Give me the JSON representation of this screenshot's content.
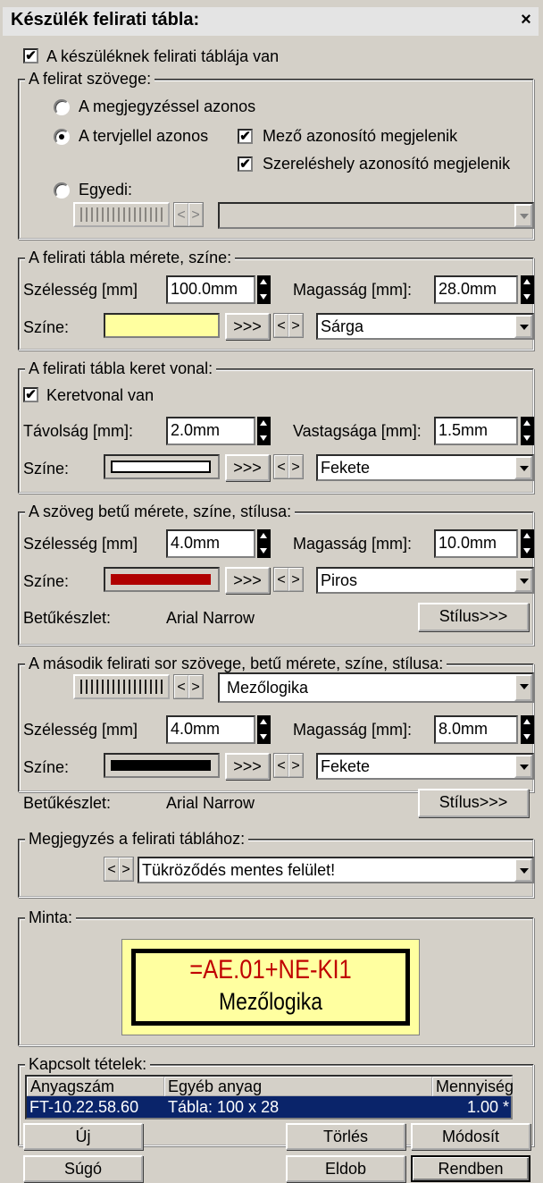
{
  "window": {
    "title": "Készülék felirati tábla:",
    "close": "×"
  },
  "main_checkbox": {
    "label": "A készüléknek felirati táblája van",
    "checked": true
  },
  "text_group": {
    "title": "A felirat szövege:",
    "radio1": "A megjegyzéssel azonos",
    "radio2": "A tervjellel azonos",
    "radio3": "Egyedi:",
    "cb1": "Mező azonosító megjelenik",
    "cb2": "Szereléshely azonosító megjelenik",
    "selected": "A tervjellel azonos"
  },
  "size_group": {
    "title": "A felirati tábla mérete, színe:",
    "width_label": "Szélesség [mm]",
    "width": "100.0mm",
    "height_label": "Magasság [mm]:",
    "height": "28.0mm",
    "color_label": "Színe:",
    "color": "Sárga",
    "color_hex": "#ffffa0",
    "pick": ">>>"
  },
  "frame_group": {
    "title": "A felirati tábla keret vonal:",
    "cb": "Keretvonal van",
    "dist_label": "Távolság [mm]:",
    "dist": "2.0mm",
    "thick_label": "Vastagsága [mm]:",
    "thick": "1.5mm",
    "color_label": "Színe:",
    "color": "Fekete",
    "pick": ">>>"
  },
  "font_group": {
    "title": "A szöveg betű mérete, színe, stílusa:",
    "width_label": "Szélesség [mm]",
    "width": "4.0mm",
    "height_label": "Magasság [mm]:",
    "height": "10.0mm",
    "color_label": "Színe:",
    "color": "Piros",
    "color_hex": "#b00000",
    "pick": ">>>",
    "font_label": "Betűkészlet:",
    "font": "Arial Narrow",
    "style_btn": "Stílus>>>"
  },
  "second_group": {
    "title": "A második felirati sor szövege, betű mérete, színe, stílusa:",
    "text": "Mezőlogika",
    "width_label": "Szélesség [mm]",
    "width": "4.0mm",
    "height_label": "Magasság [mm]:",
    "height": "8.0mm",
    "color_label": "Színe:",
    "color": "Fekete",
    "pick": ">>>",
    "font_label": "Betűkészlet:",
    "font": "Arial Narrow",
    "style_btn": "Stílus>>>"
  },
  "note_group": {
    "title": "Megjegyzés a felirati táblához:",
    "text": "Tükröződés mentes felület!"
  },
  "sample_group": {
    "title": "Minta:",
    "line1": "=AE.01+NE-KI1",
    "line2": "Mezőlogika"
  },
  "linked_group": {
    "title": "Kapcsolt tételek:",
    "columns": [
      "Anyagszám",
      "Egyéb anyag",
      "Mennyiség"
    ],
    "rows": [
      [
        "FT-10.22.58.60",
        "Tábla: 100 x 28",
        "1.00 *"
      ]
    ],
    "new_btn": "Új",
    "delete_btn": "Törlés",
    "modify_btn": "Módosít"
  },
  "footer": {
    "help": "Súgó",
    "discard": "Eldob",
    "ok": "Rendben"
  }
}
